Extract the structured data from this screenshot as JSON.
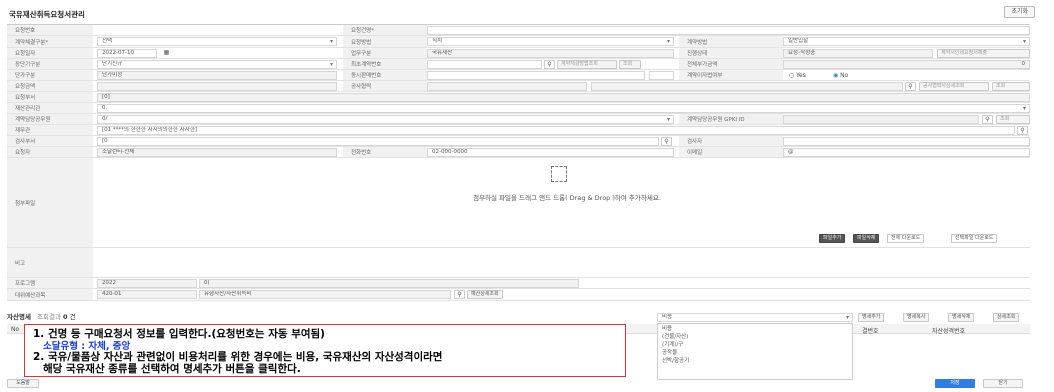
{
  "header": {
    "title": "국유재산취득요청서관리",
    "reset": "초기화"
  },
  "rows": {
    "req_no": {
      "label": "요청번호",
      "value": ""
    },
    "req_name": {
      "label": "요청건명*",
      "value": ""
    },
    "contract_type": {
      "label": "계약체결구분*",
      "value": "선택"
    },
    "req_method": {
      "label": "요청방법",
      "value": "직치"
    },
    "contract_method": {
      "label": "계약방법",
      "value": "일반입찰"
    },
    "req_date": {
      "label": "요청일자",
      "value": "2022-07-10"
    },
    "biz_type": {
      "label": "업무구분",
      "value": "국유재산"
    },
    "progress": {
      "label": "진행상태",
      "value": "요청-작성중"
    },
    "long_term": {
      "label": "장단기구분",
      "value": "단기신규"
    },
    "first_contract_no": {
      "label": "최초계약번호",
      "value": ""
    },
    "total_vat": {
      "label": "전체부가금액",
      "value": "0"
    },
    "unit_type": {
      "label": "단가구분",
      "value": "단가미정"
    },
    "related_contract": {
      "label": "동시판매번호",
      "value": ""
    },
    "sacrifice": {
      "label": "계약이자법여부",
      "yes": "Yes",
      "no": "No"
    },
    "req_amount": {
      "label": "요청금액",
      "value": ""
    },
    "vendor": {
      "label": "공사협력",
      "value": ""
    },
    "req_dept": {
      "label": "요청부서",
      "value": "[0]"
    },
    "asset_manager": {
      "label": "재산관리관",
      "value": "0."
    },
    "contract_duty": {
      "label": "계약담당공무원",
      "value": "0/"
    },
    "contract_duty_id": {
      "label": "계약담당공무원 GPKI ID",
      "value": ""
    },
    "finance": {
      "label": "재무관",
      "value": "[01 ****의 한한한 자자의의한한 자자한]"
    },
    "inspect_dept": {
      "label": "검사부서",
      "value": "[0"
    },
    "inspector": {
      "label": "검사자",
      "value": ""
    },
    "requester": {
      "label": "요청자",
      "value": "소날런티-전체"
    },
    "phone": {
      "label": "전화번호",
      "value": "02-000-0000"
    },
    "email": {
      "label": "이메일",
      "value": "@"
    },
    "attach": {
      "label": "첨부파일",
      "drop_text": "첨부하실 파일을 드래그 앤드 드롭( Drag & Drop )하여 추가하세요."
    },
    "remark": {
      "label": "비고",
      "value": ""
    },
    "program": {
      "label": "프로그램",
      "value": "2022",
      "value2": "0("
    },
    "budget": {
      "label": "대위예산과목",
      "value": "420-01",
      "value2": "유형자산/자산취득비",
      "btn": "예산상세조회"
    }
  },
  "buttons": {
    "search_contract": "계약체결방법조회",
    "view": "조회",
    "print_req": "계약서인쇄요청서제출",
    "file_add": "파일추가",
    "file_del": "파일삭제",
    "all_down": "전체 다운로드",
    "sel_down": "선택파일 다운로드",
    "vendor_search": "공사협력사상세조회",
    "vendor_view": "조회",
    "duty_view": "조회",
    "add_detail": "명세추가",
    "copy_detail": "명세복사",
    "del_detail": "명세삭제",
    "view_detail": "상세조회",
    "cert": "도움말",
    "save": "저장",
    "close": "닫기"
  },
  "list": {
    "title": "자산명세",
    "count_label": "조회결과",
    "count": "0",
    "unit": "건",
    "cat_select": "비용",
    "options": [
      "비용",
      "(건물/자산)",
      "(기계)/구",
      "공작물",
      "선박/항공기"
    ],
    "col_no": "No",
    "col_kind": "종류",
    "col_qty": "단위",
    "col_approve": "결번호",
    "col_asset": "자산성격번호"
  },
  "note": {
    "line1": "1. 건명 등 구매요청서 정보를 입력한다.(요청번호는 자동 부여됨)",
    "line2": "소달유형 : 자체, 중앙",
    "line3": "2. 국유/물품상 자산과 관련없이 비용처리를 위한 경우에는 비용, 국유재산의 자산성격이라면",
    "line4": "해당 국유재산 종류를 선택하여 명세추가 버튼을 클릭한다."
  }
}
